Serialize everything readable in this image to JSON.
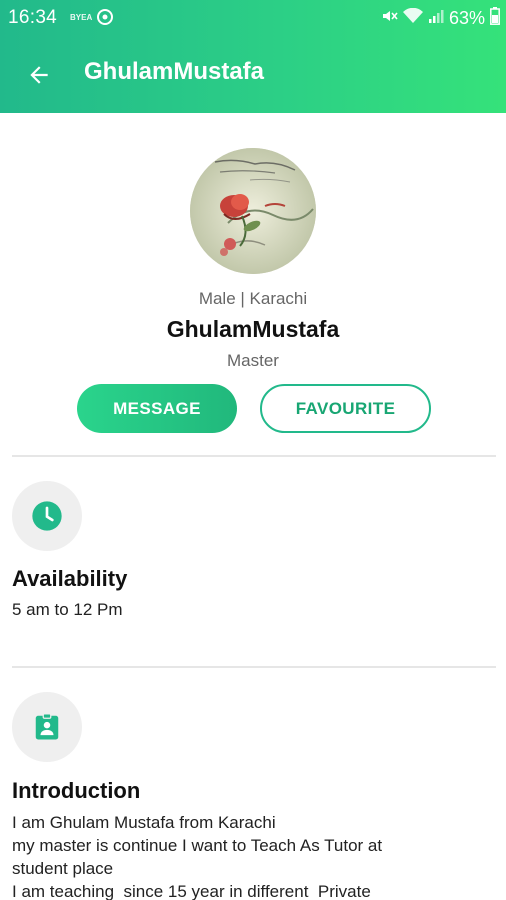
{
  "status_bar": {
    "time": "16:34",
    "mini_label": "BYEA",
    "battery_percent": "63%",
    "icons": [
      "sync-icon",
      "mute-icon",
      "wifi-icon",
      "signal-icon",
      "battery-icon"
    ]
  },
  "app_bar": {
    "back_icon": "arrow-left-icon",
    "title": "GhulamMustafa",
    "gradient_colors": [
      "#22b98b",
      "#35e27a"
    ]
  },
  "profile": {
    "avatar_icon": "profile-photo-rose",
    "gender_city": "Male | Karachi",
    "name": "GhulamMustafa",
    "role": "Master",
    "message_label": "MESSAGE",
    "favourite_label": "FAVOURITE"
  },
  "availability": {
    "icon": "clock-icon",
    "title": "Availability",
    "text": "5 am to 12 Pm"
  },
  "introduction": {
    "icon": "id-badge-icon",
    "title": "Introduction",
    "lines": [
      "I am Ghulam Mustafa from Karachi",
      "my master is continue I want to Teach As Tutor at",
      "student place",
      "I am teaching  since 15 year in different  Private"
    ]
  },
  "accent_color": "#22b98b"
}
